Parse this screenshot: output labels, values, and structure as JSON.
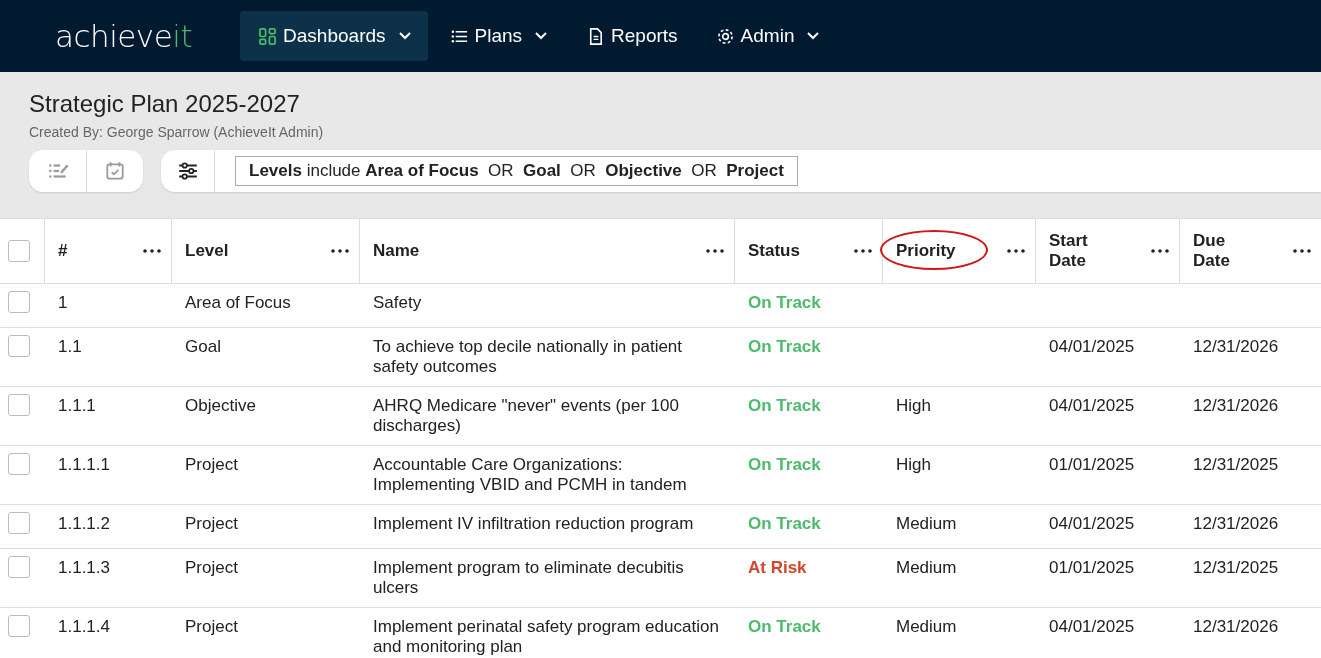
{
  "nav": {
    "logo_main": "achieve",
    "logo_accent": "it",
    "items": [
      {
        "label": "Dashboards",
        "dropdown": true,
        "selected": true
      },
      {
        "label": "Plans",
        "dropdown": true,
        "selected": false
      },
      {
        "label": "Reports",
        "dropdown": false,
        "selected": false
      },
      {
        "label": "Admin",
        "dropdown": true,
        "selected": false
      }
    ]
  },
  "plan": {
    "title": "Strategic Plan 2025-2027",
    "created_by": "Created By: George Sparrow (AchieveIt Admin)"
  },
  "filter": "**Levels** include **Area of Focus**  OR  **Goal**  OR  **Objective**  OR  **Project**",
  "table": {
    "all_checked": false,
    "columns": [
      {
        "label": "#",
        "circled": false
      },
      {
        "label": "Level",
        "circled": false
      },
      {
        "label": "Name",
        "circled": false
      },
      {
        "label": "Status",
        "circled": false
      },
      {
        "label": "Priority",
        "circled": true
      },
      {
        "label": "Start Date",
        "circled": false
      },
      {
        "label": "Due Date",
        "circled": false
      }
    ],
    "rows": [
      {
        "checked": false,
        "number": "1",
        "level": "Area of Focus",
        "name": "Safety",
        "status": "On Track",
        "color": "#4cbb6c",
        "priority": "",
        "start": "",
        "due": ""
      },
      {
        "checked": false,
        "number": "1.1",
        "level": "Goal",
        "name": "To achieve top decile nationally in patient safety outcomes",
        "status": "On Track",
        "color": "#4cbb6c",
        "priority": "",
        "start": "04/01/2025",
        "due": "12/31/2026"
      },
      {
        "checked": false,
        "number": "1.1.1",
        "level": "Objective",
        "name": "AHRQ Medicare \"never\" events (per 100 discharges)",
        "status": "On Track",
        "color": "#4cbb6c",
        "priority": "High",
        "start": "04/01/2025",
        "due": "12/31/2026"
      },
      {
        "checked": false,
        "number": "1.1.1.1",
        "level": "Project",
        "name": "Accountable Care Organizations: Implementing VBID and PCMH in tandem",
        "status": "On Track",
        "color": "#4cbb6c",
        "priority": "High",
        "start": "01/01/2025",
        "due": "12/31/2025"
      },
      {
        "checked": false,
        "number": "1.1.1.2",
        "level": "Project",
        "name": "Implement IV infiltration reduction program",
        "status": "On Track",
        "color": "#4cbb6c",
        "priority": "Medium",
        "start": "04/01/2025",
        "due": "12/31/2026"
      },
      {
        "checked": false,
        "number": "1.1.1.3",
        "level": "Project",
        "name": "Implement program to eliminate decubitis ulcers",
        "status": "At Risk",
        "color": "#d2452b",
        "priority": "Medium",
        "start": "01/01/2025",
        "due": "12/31/2025"
      },
      {
        "checked": false,
        "number": "1.1.1.4",
        "level": "Project",
        "name": "Implement perinatal safety program education and monitoring plan",
        "status": "On Track",
        "color": "#4cbb6c",
        "priority": "Medium",
        "start": "04/01/2025",
        "due": "12/31/2026"
      }
    ]
  }
}
